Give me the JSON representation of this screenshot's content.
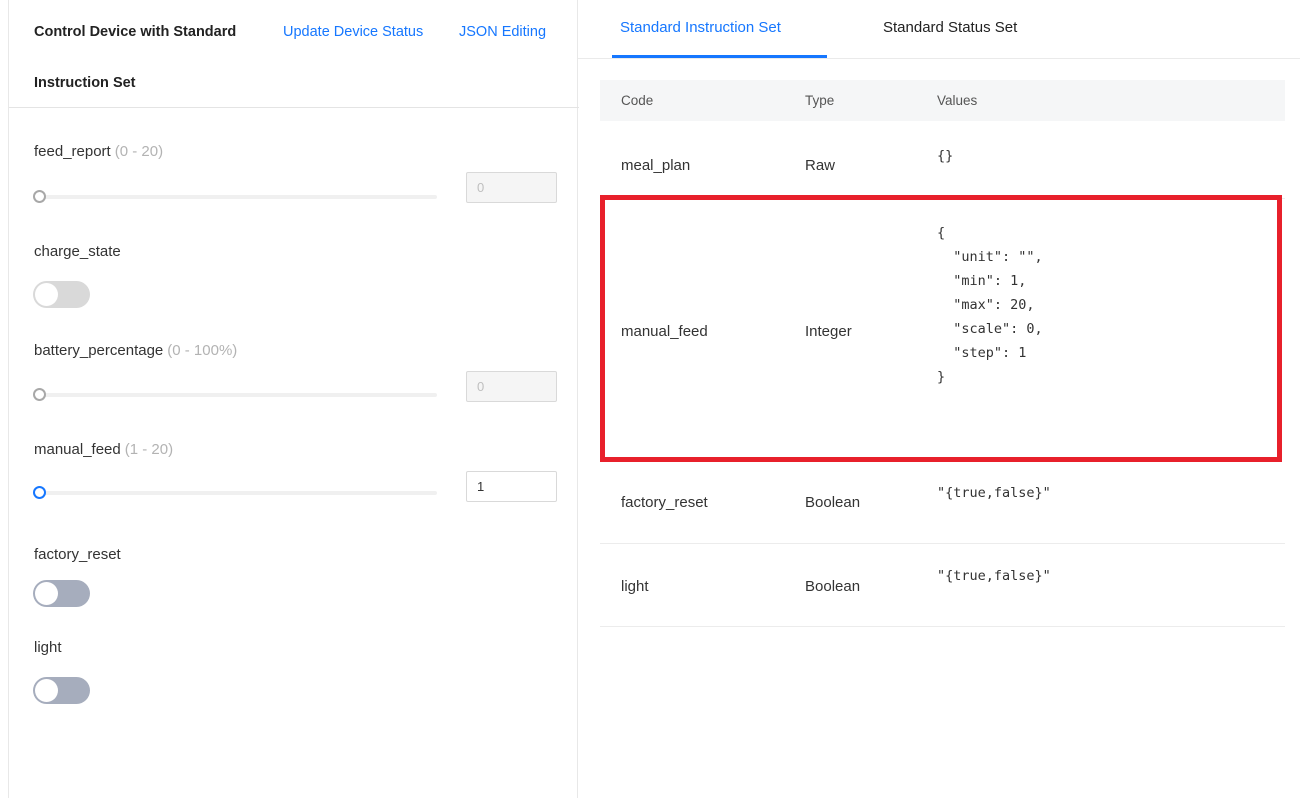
{
  "left": {
    "title_line1": "Control Device with Standard",
    "title_line2": "Instruction Set",
    "link_update": "Update Device Status",
    "link_json": "JSON Editing",
    "controls": {
      "feed_report": {
        "label": "feed_report",
        "range": "(0 - 20)",
        "value": "0",
        "level": 0
      },
      "charge_state": {
        "label": "charge_state",
        "on": false
      },
      "battery_percentage": {
        "label": "battery_percentage",
        "range": "(0 - 100%)",
        "value": "0",
        "level": 0
      },
      "manual_feed": {
        "label": "manual_feed",
        "range": "(1 - 20)",
        "value": "1",
        "level": 0
      },
      "factory_reset": {
        "label": "factory_reset",
        "on": false
      },
      "light": {
        "label": "light",
        "on": false
      }
    }
  },
  "right": {
    "tabs": [
      {
        "label": "Standard Instruction Set",
        "active": true
      },
      {
        "label": "Standard Status Set",
        "active": false
      }
    ],
    "columns": [
      "Code",
      "Type",
      "Values"
    ],
    "rows": [
      {
        "code": "meal_plan",
        "type": "Raw",
        "values": "{}"
      },
      {
        "code": "manual_feed",
        "type": "Integer",
        "values": "{\n  \"unit\": \"\",\n  \"min\": 1,\n  \"max\": 20,\n  \"scale\": 0,\n  \"step\": 1\n}"
      },
      {
        "code": "factory_reset",
        "type": "Boolean",
        "values": "\"{true,false}\""
      },
      {
        "code": "light",
        "type": "Boolean",
        "values": "\"{true,false}\""
      }
    ]
  },
  "colors": {
    "accent": "#1677ff",
    "highlight_border": "#e8202b",
    "toggle_off_light": "#d9d9d9",
    "toggle_off_dark": "#a6adbd"
  }
}
